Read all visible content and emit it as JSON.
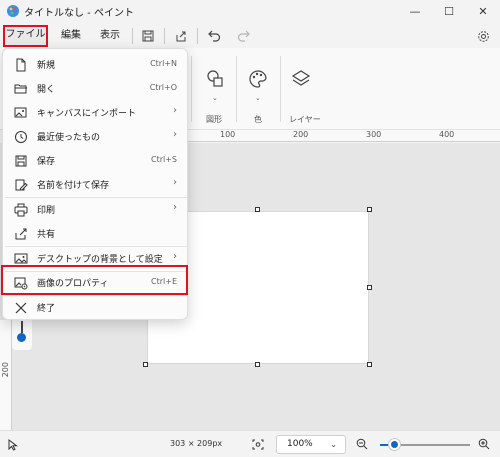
{
  "window": {
    "title": "タイトルなし - ペイント",
    "minimize_glyph": "—",
    "maximize_glyph": "☐",
    "close_glyph": "✕"
  },
  "menubar": {
    "file": "ファイル",
    "edit": "編集",
    "view": "表示"
  },
  "ribbon": {
    "shapes_label": "図形",
    "color_label": "色",
    "layers_label": "レイヤー",
    "chevron": "⌄"
  },
  "ruler": {
    "marks": [
      "100",
      "200",
      "300",
      "400"
    ],
    "vertical_mark": "200"
  },
  "file_menu": {
    "items": [
      {
        "label": "新規",
        "shortcut": "Ctrl+N",
        "icon": "new-file-icon"
      },
      {
        "label": "開く",
        "shortcut": "Ctrl+O",
        "icon": "folder-open-icon"
      },
      {
        "label": "キャンバスにインポート",
        "arrow": "›",
        "icon": "import-image-icon"
      },
      {
        "label": "最近使ったもの",
        "arrow": "›",
        "icon": "clock-icon"
      },
      {
        "label": "保存",
        "shortcut": "Ctrl+S",
        "icon": "save-icon"
      },
      {
        "label": "名前を付けて保存",
        "arrow": "›",
        "icon": "save-as-icon"
      },
      {
        "label": "印刷",
        "arrow": "›",
        "icon": "print-icon"
      },
      {
        "label": "共有",
        "icon": "share-icon"
      },
      {
        "label": "デスクトップの背景として設定",
        "arrow": "›",
        "icon": "desktop-background-icon"
      },
      {
        "label": "画像のプロパティ",
        "shortcut": "Ctrl+E",
        "icon": "image-properties-icon"
      },
      {
        "label": "終了",
        "icon": "exit-icon"
      }
    ]
  },
  "status": {
    "dimensions": "303 × 209px",
    "zoom": "100%"
  },
  "colors": {
    "accent": "#1366c4",
    "highlight": "#e0121b"
  }
}
